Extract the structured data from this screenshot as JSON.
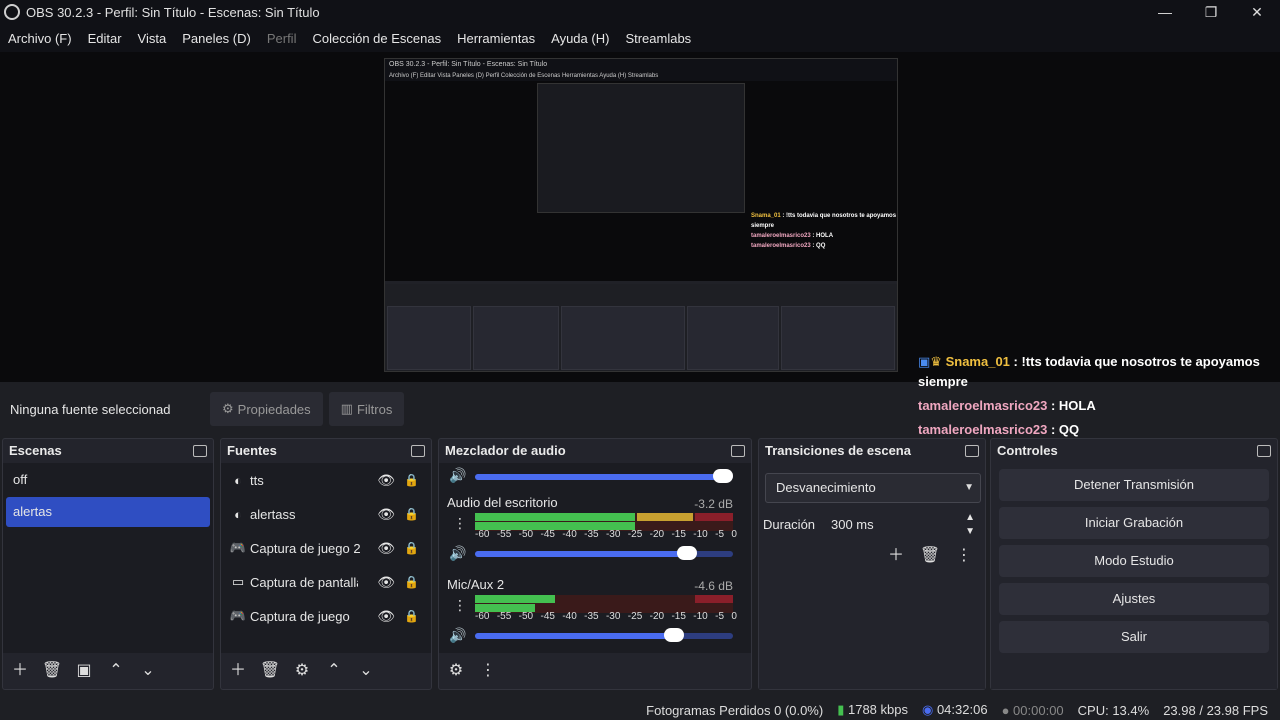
{
  "window": {
    "title": "OBS 30.2.3 - Perfil: Sin Título - Escenas: Sin Título",
    "minimize": "—",
    "restore": "❐",
    "close": "✕"
  },
  "menu": [
    "Archivo (F)",
    "Editar",
    "Vista",
    "Paneles (D)",
    "Perfil",
    "Colección de Escenas",
    "Herramientas",
    "Ayuda (H)",
    "Streamlabs"
  ],
  "preview": {
    "title": "OBS 30.2.3 - Perfil: Sin Título - Escenas: Sin Título",
    "menu": "Archivo (F)  Editar  Vista  Paneles (D)  Perfil  Colección de Escenas  Herramientas  Ayuda (H)  Streamlabs",
    "nested_chat": [
      {
        "user": "Snama_01",
        "msg": ": !tts todavia que nosotros te apoyamos siempre"
      },
      {
        "user": "tamaleroelmasrico23",
        "msg": ": HOLA"
      },
      {
        "user": "tamaleroelmasrico23",
        "msg": ": QQ"
      }
    ]
  },
  "chat": [
    {
      "user": "Snama_01",
      "msg": " : !tts todavia que nosotros te apoyamos siempre"
    },
    {
      "user": "tamaleroelmasrico23",
      "msg": " : HOLA"
    },
    {
      "user": "tamaleroelmasrico23",
      "msg": " : QQ"
    }
  ],
  "toolbar": {
    "no_source": "Ninguna fuente seleccionad",
    "properties": "Propiedades",
    "filters": "Filtros"
  },
  "scenes": {
    "title": "Escenas",
    "items": [
      "off",
      "alertas"
    ],
    "selected": 1
  },
  "sources": {
    "title": "Fuentes",
    "items": [
      {
        "name": "tts",
        "icon": "browser-icon"
      },
      {
        "name": "alertass",
        "icon": "browser-icon"
      },
      {
        "name": "Captura de juego 2",
        "icon": "gamepad-icon"
      },
      {
        "name": "Captura de pantalla",
        "icon": "monitor-icon"
      },
      {
        "name": "Captura de juego",
        "icon": "gamepad-icon"
      }
    ]
  },
  "mixer": {
    "title": "Mezclador de audio",
    "ticks": [
      "-60",
      "-55",
      "-50",
      "-45",
      "-40",
      "-35",
      "-30",
      "-25",
      "-20",
      "-15",
      "-10",
      "-5",
      "0"
    ],
    "channels": [
      {
        "name": "Audio del escritorio",
        "db": "-3.2 dB",
        "volume": 0.82
      },
      {
        "name": "Mic/Aux 2",
        "db": "-4.6 dB",
        "volume": 0.77
      }
    ],
    "top_volume": 0.96
  },
  "transitions": {
    "title": "Transiciones de escena",
    "selected": "Desvanecimiento",
    "duration_label": "Duración",
    "duration_value": "300 ms"
  },
  "controls": {
    "title": "Controles",
    "buttons": [
      "Detener Transmisión",
      "Iniciar Grabación",
      "Modo Estudio",
      "Ajustes",
      "Salir"
    ]
  },
  "status": {
    "dropped": "Fotogramas Perdidos 0 (0.0%)",
    "bitrate": "1788 kbps",
    "stream_time": "04:32:06",
    "rec_time": "00:00:00",
    "cpu": "CPU: 13.4%",
    "fps": "23.98 / 23.98 FPS"
  }
}
